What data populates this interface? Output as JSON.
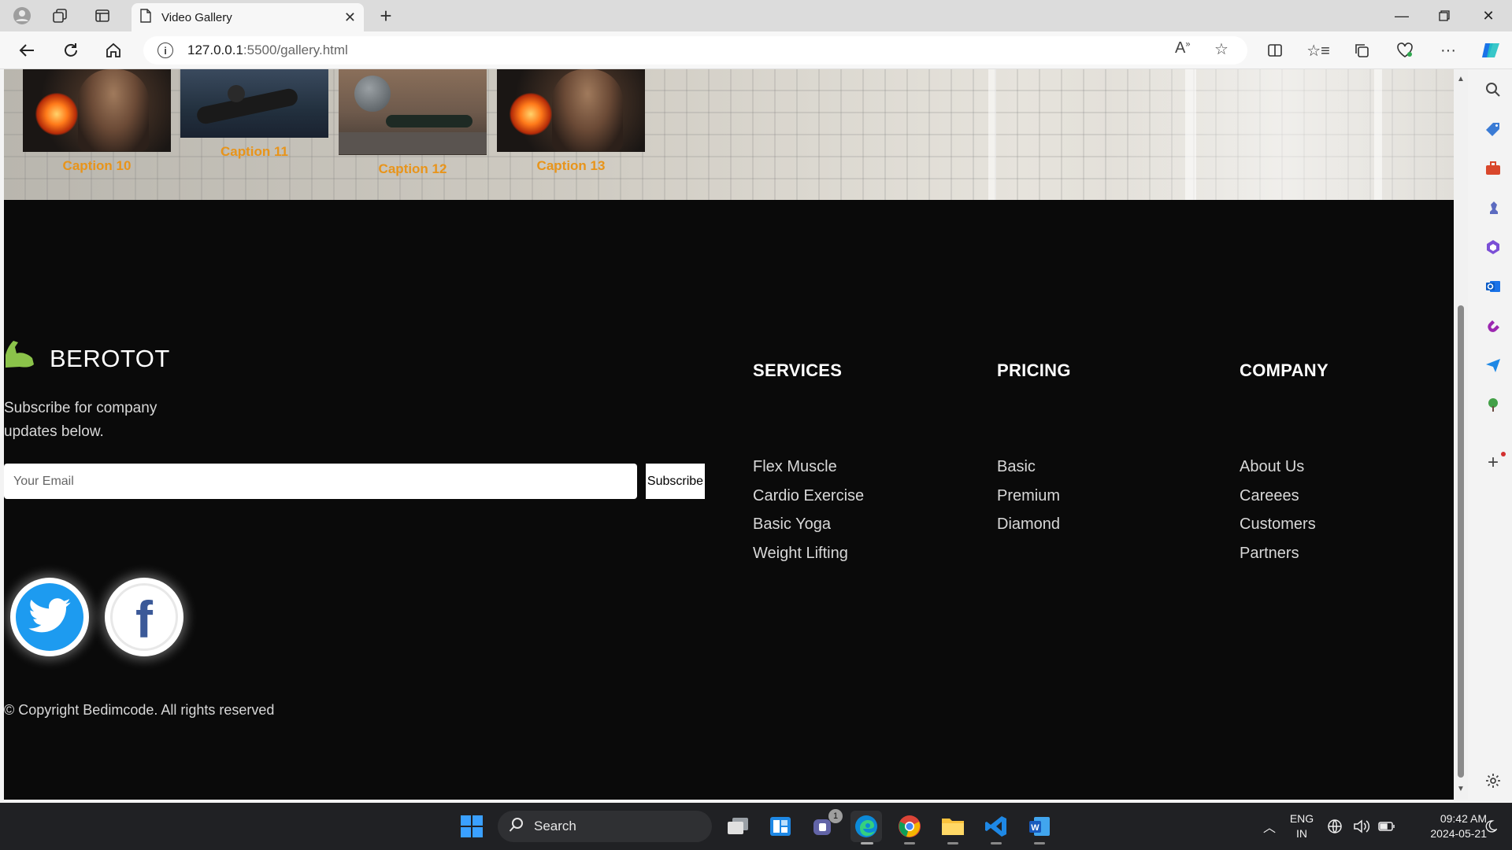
{
  "browser": {
    "tab_title": "Video Gallery",
    "url_host": "127.0.0.1",
    "url_rest": ":5500/gallery.html"
  },
  "gallery": {
    "captions": [
      "Caption 10",
      "Caption 11",
      "Caption 12",
      "Caption 13"
    ],
    "caption_color": "#e8941a"
  },
  "footer": {
    "brand_name": "BEROTOT",
    "subscribe_text": "Subscribe for company updates below.",
    "email_placeholder": "Your Email",
    "subscribe_label": "Subscribe",
    "social": [
      "twitter-icon",
      "facebook-icon"
    ],
    "copyright": "© Copyright Bedimcode. All rights reserved",
    "columns": [
      {
        "heading": "SERVICES",
        "items": [
          "Flex Muscle",
          "Cardio Exercise",
          "Basic Yoga",
          "Weight Lifting"
        ]
      },
      {
        "heading": "PRICING",
        "items": [
          "Basic",
          "Premium",
          "Diamond"
        ]
      },
      {
        "heading": "COMPANY",
        "items": [
          "About Us",
          "Careees",
          "Customers",
          "Partners"
        ]
      }
    ],
    "logo_color": "#8bc34a"
  },
  "taskbar": {
    "search_label": "Search",
    "chat_badge": "1",
    "language": "ENG",
    "region": "IN",
    "time": "09:42 AM",
    "date": "2024-05-21"
  }
}
